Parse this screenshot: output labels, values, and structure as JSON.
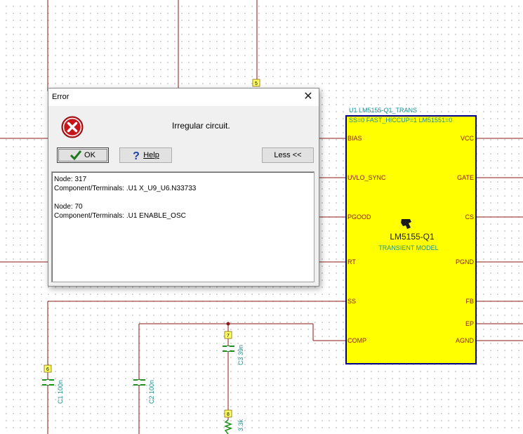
{
  "schematic": {
    "component_ref": "U1 LM5155-Q1_TRANS",
    "component_params": "SS=0 FAST_HICCUP=1 LM51551=0",
    "chip_name": "LM5155-Q1",
    "chip_subtitle": "TRANSIENT MODEL",
    "left_pins": [
      "BIAS",
      "UVLO_SYNC",
      "PGOOD",
      "RT",
      "SS",
      "COMP"
    ],
    "right_pins": [
      "VCC",
      "GATE",
      "CS",
      "PGND",
      "FB",
      "EP",
      "AGND"
    ],
    "c1_label": "C1 100n",
    "c2_label": "C2 100n",
    "c3_label": "C3 39n",
    "r_label": "3.3k",
    "node_tags": [
      "5",
      "6",
      "7",
      "8"
    ],
    "chip_color": "#ffff00",
    "wire_color": "#8b1a1a",
    "label_color": "#1f8f8f"
  },
  "dialog": {
    "title": "Error",
    "close_glyph": "✕",
    "message": "Irregular circuit.",
    "ok_label": "OK",
    "help_label": "Help",
    "less_label": "Less <<",
    "details": [
      "Node: 317",
      "Component/Terminals: .U1 X_U9_U6.N33733",
      "",
      "Node: 70",
      "Component/Terminals: .U1 ENABLE_OSC"
    ],
    "icons": {
      "error": "error-x-icon",
      "ok": "checkmark-icon",
      "help": "question-mark-icon",
      "close": "close-icon"
    }
  }
}
